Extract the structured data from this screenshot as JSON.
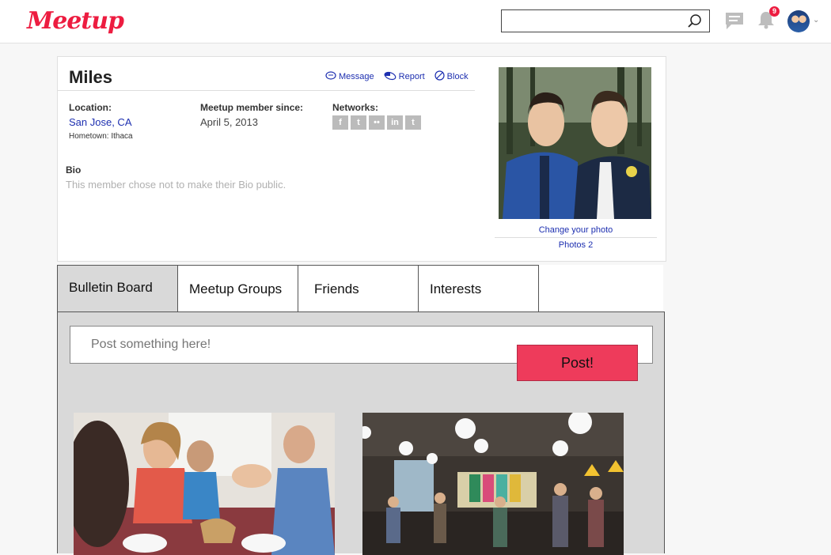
{
  "header": {
    "logo_text": "Meetup",
    "search_placeholder": "",
    "notification_count": "9",
    "brand_color": "#ed1c40"
  },
  "profile": {
    "name": "Miles",
    "actions": {
      "message": "Message",
      "report": "Report",
      "block": "Block"
    },
    "location_label": "Location:",
    "location_value": "San Jose, CA",
    "hometown": "Hometown: Ithaca",
    "since_label": "Meetup member since:",
    "since_value": "April 5, 2013",
    "networks_label": "Networks:",
    "networks": [
      "f",
      "t",
      "••",
      "in",
      "t"
    ],
    "bio_label": "Bio",
    "bio_text": "This member chose not to make their Bio public.",
    "change_photo": "Change your photo",
    "photos_link": "Photos 2"
  },
  "tabs": [
    {
      "label": "Bulletin Board",
      "active": true
    },
    {
      "label": "Meetup Groups",
      "active": false
    },
    {
      "label": "Friends",
      "active": false
    },
    {
      "label": "Interests",
      "active": false
    }
  ],
  "board": {
    "post_placeholder": "Post something here!",
    "post_button": "Post!",
    "post_button_color": "#ee3b5b"
  }
}
